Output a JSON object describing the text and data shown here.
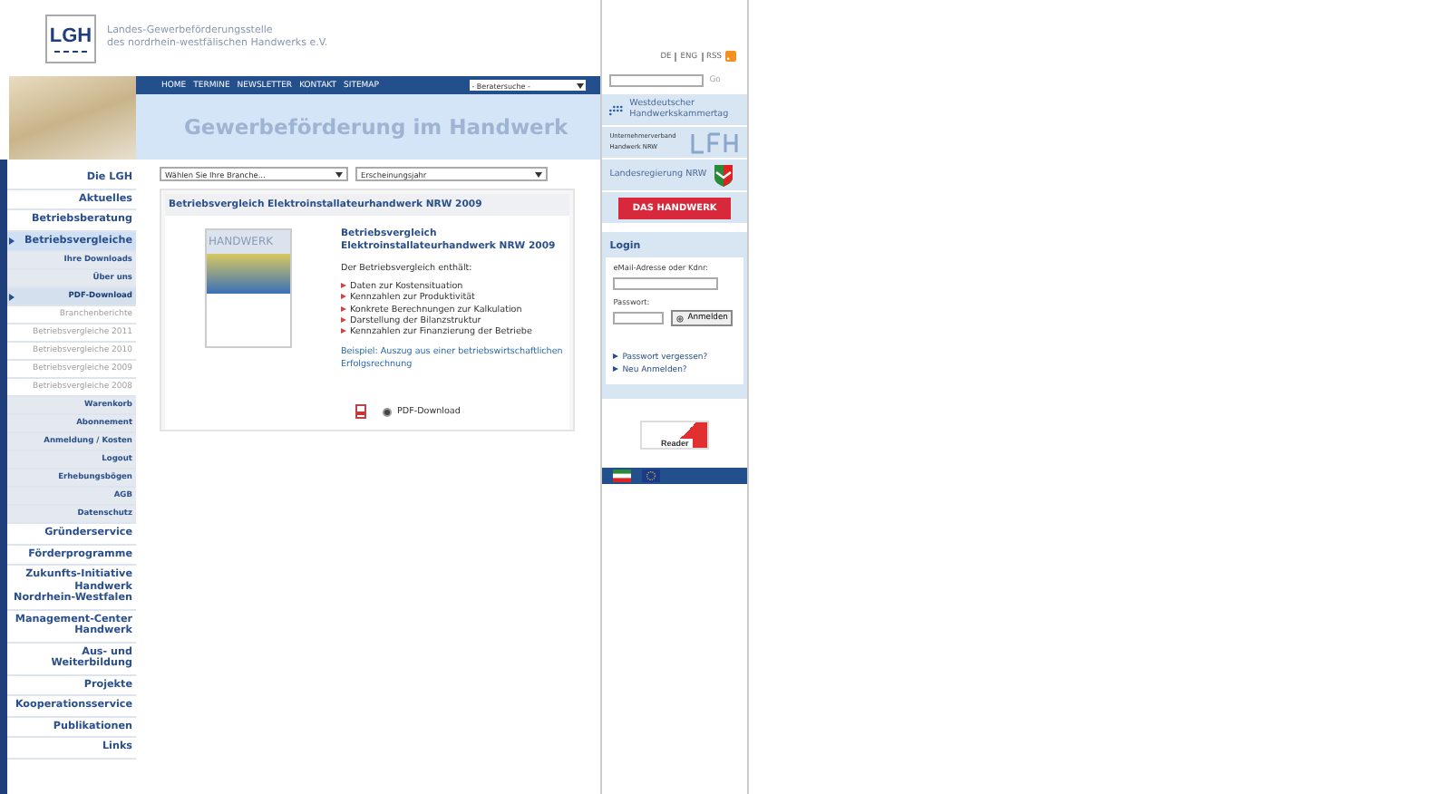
{
  "header": {
    "logo": "LGH",
    "org_lines": [
      "Landes-Gewerbeförderungsstelle",
      "des nordrhein-westfälischen Handwerks e.V."
    ]
  },
  "lang_links": [
    "DE",
    "ENG",
    "RSS"
  ],
  "search": {
    "button": "Go"
  },
  "top_nav": [
    "HOME",
    "TERMINE",
    "NEWSLETTER",
    "KONTAKT",
    "SITEMAP"
  ],
  "advisor_select": "- Beratersuche -",
  "banner_title": "Gewerbeförderung im Handwerk",
  "sidebar": {
    "items": [
      {
        "label": "Die LGH",
        "kind": "main",
        "selected": false
      },
      {
        "label": "Aktuelles",
        "kind": "main",
        "selected": false
      },
      {
        "label": "Betriebsberatung",
        "kind": "main",
        "selected": false
      },
      {
        "label": "Betriebsvergleiche",
        "kind": "main",
        "selected": true
      },
      {
        "label": "Ihre Downloads",
        "kind": "sub",
        "selected": false
      },
      {
        "label": "Über uns",
        "kind": "sub",
        "selected": false
      },
      {
        "label": "PDF-Download",
        "kind": "sub",
        "selected": true
      },
      {
        "label": "Branchenberichte",
        "kind": "leaf",
        "selected": false
      },
      {
        "label": "Betriebsvergleiche 2011",
        "kind": "leaf",
        "selected": false
      },
      {
        "label": "Betriebsvergleiche 2010",
        "kind": "leaf",
        "selected": false
      },
      {
        "label": "Betriebsvergleiche 2009",
        "kind": "leaf",
        "selected": false
      },
      {
        "label": "Betriebsvergleiche 2008",
        "kind": "leaf",
        "selected": false
      },
      {
        "label": "Warenkorb",
        "kind": "sub",
        "selected": false
      },
      {
        "label": "Abonnement",
        "kind": "sub",
        "selected": false
      },
      {
        "label": "Anmeldung / Kosten",
        "kind": "sub",
        "selected": false
      },
      {
        "label": "Logout",
        "kind": "sub",
        "selected": false
      },
      {
        "label": "Erhebungsbögen",
        "kind": "sub",
        "selected": false
      },
      {
        "label": "AGB",
        "kind": "sub",
        "selected": false
      },
      {
        "label": "Datenschutz",
        "kind": "sub",
        "selected": false
      },
      {
        "label": "Gründerservice",
        "kind": "main",
        "selected": false
      },
      {
        "label": "Förderprogramme",
        "kind": "main",
        "selected": false
      },
      {
        "label": "Zukunfts-Initiative Handwerk Nordrhein-Westfalen",
        "kind": "main",
        "selected": false
      },
      {
        "label": "Management-Center Handwerk",
        "kind": "main",
        "selected": false
      },
      {
        "label": "Aus- und Weiterbildung",
        "kind": "main",
        "selected": false
      },
      {
        "label": "Projekte",
        "kind": "main",
        "selected": false
      },
      {
        "label": "Kooperationsservice",
        "kind": "main",
        "selected": false
      },
      {
        "label": "Publikationen",
        "kind": "main",
        "selected": false
      },
      {
        "label": "Links",
        "kind": "main",
        "selected": false
      }
    ]
  },
  "filters": [
    "Wählen Sie Ihre Branche...",
    "Erscheinungsjahr"
  ],
  "article": {
    "heading": "Betriebsvergleich Elektroinstallateurhandwerk NRW 2009",
    "cover_title": "HANDWERK",
    "title": "Betriebsvergleich Elektroinstallateurhandwerk NRW 2009",
    "intro": "Der Betriebsvergleich enthält:",
    "bullets": [
      "Daten zur Kostensituation",
      "Kennzahlen zur Produktivität",
      "Konkrete Berechnungen zur Kalkulation",
      "Darstellung der Bilanzstruktur",
      "Kennzahlen zur Finanzierung der Betriebe"
    ],
    "example_link": "Beispiel: Auszug aus einer betriebswirtschaftlichen Erfolgsrechnung",
    "download": {
      "label": "PDF-Download",
      "selected": true
    }
  },
  "partners": [
    {
      "kind": "whkt",
      "label": "Westdeutscher Handwerkskammertag"
    },
    {
      "kind": "lfh",
      "label": "Unternehmerverband Handwerk NRW"
    },
    {
      "kind": "nrw",
      "label": "Landesregierung NRW"
    },
    {
      "kind": "red",
      "label": "DAS HANDWERK"
    }
  ],
  "login": {
    "title": "Login",
    "user_label": "eMail-Adresse oder Kdnr:",
    "password_label": "Passwort:",
    "button": "Anmelden",
    "links": [
      "Passwort vergessen?",
      "Neu Anmelden?"
    ]
  },
  "reader_badge": "Reader"
}
